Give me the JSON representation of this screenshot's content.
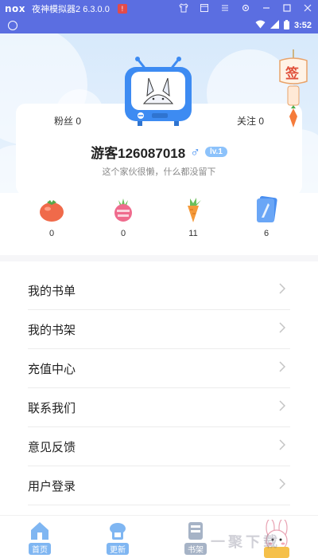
{
  "emulator": {
    "logo": "nox",
    "title": "夜神模拟器2 6.3.0.0",
    "badge": "!",
    "controls": [
      "shirt-icon",
      "window-icon",
      "menu-icon",
      "gear-icon",
      "minimize-icon",
      "maximize-icon",
      "close-icon"
    ]
  },
  "status_bar": {
    "time": "3:52"
  },
  "profile": {
    "fans_label": "粉丝 0",
    "follow_label": "关注 0",
    "username": "游客126087018",
    "gender_symbol": "♂",
    "level": "lv.1",
    "signature": "这个家伙很懒，什么都没留下",
    "signin_label": "签"
  },
  "stats": [
    {
      "icon": "tomato-icon",
      "value": "0",
      "color": "#f06a4a"
    },
    {
      "icon": "radish-icon",
      "value": "0",
      "color": "#ef6b8d"
    },
    {
      "icon": "carrot-icon",
      "value": "11",
      "color": "#f59a3a"
    },
    {
      "icon": "book-card-icon",
      "value": "6",
      "color": "#4a8ff0"
    }
  ],
  "menu": [
    {
      "label": "我的书单"
    },
    {
      "label": "我的书架"
    },
    {
      "label": "充值中心"
    },
    {
      "label": "联系我们"
    },
    {
      "label": "意见反馈"
    },
    {
      "label": "用户登录"
    }
  ],
  "bottom_nav": [
    {
      "label": "首页",
      "icon": "home-icon"
    },
    {
      "label": "更新",
      "icon": "update-icon"
    },
    {
      "label": "书架",
      "icon": "bookshelf-icon"
    },
    {
      "label": "",
      "icon": "bunny-mascot-icon"
    }
  ],
  "watermark": "一聚下载",
  "colors": {
    "emulator_bar": "#5b6ee1",
    "accent": "#3d8bf2",
    "header_bg": "#dbeafb"
  }
}
